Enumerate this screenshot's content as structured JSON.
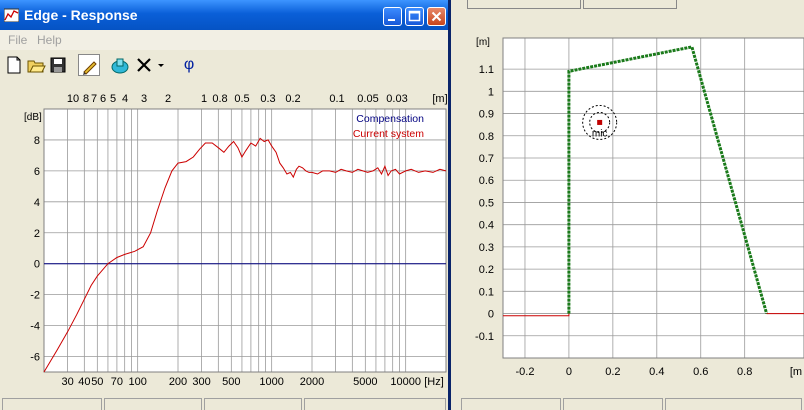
{
  "window": {
    "title": "Edge - Response"
  },
  "menu": {
    "file": "File",
    "help": "Help"
  },
  "icons": [
    "app-icon",
    "minimize-icon",
    "maximize-icon",
    "close-icon",
    "new-file-icon",
    "open-folder-icon",
    "save-icon",
    "pencil-icon",
    "mic-icon",
    "delete-icon",
    "dropdown-arrow-icon",
    "phase-icon"
  ],
  "toolbar": {
    "phase_symbol": "φ"
  },
  "response_chart": {
    "type": "line",
    "ylabel": "[dB]",
    "ylim": [
      -7,
      10
    ],
    "yticks": [
      8,
      6,
      4,
      2,
      0,
      -2,
      -4,
      -6
    ],
    "xlabel": "[Hz]",
    "xlim": [
      20,
      20000
    ],
    "xscale": "log",
    "xticks": [
      {
        "v": 30,
        "label": "30"
      },
      {
        "v": 40,
        "label": "40"
      },
      {
        "v": 50,
        "label": "50"
      },
      {
        "v": 70,
        "label": "70"
      },
      {
        "v": 100,
        "label": "100"
      },
      {
        "v": 200,
        "label": "200"
      },
      {
        "v": 300,
        "label": "300"
      },
      {
        "v": 500,
        "label": "500"
      },
      {
        "v": 1000,
        "label": "1000"
      },
      {
        "v": 2000,
        "label": "2000"
      },
      {
        "v": 5000,
        "label": "5000"
      },
      {
        "v": 10000,
        "label": "10000"
      }
    ],
    "top_axis_label": "[m]",
    "top_ticks": [
      "10",
      "8",
      "7",
      "6",
      "5",
      "4",
      "3",
      "2",
      "1",
      "0.8",
      "0.5",
      "0.3",
      "0.2",
      "0.1",
      "0.05",
      "0.03"
    ],
    "grid": true,
    "legend_position": "top-right",
    "series": [
      {
        "name": "Compensation",
        "color": "#000080",
        "points": [
          [
            20,
            0
          ],
          [
            20000,
            0
          ]
        ]
      },
      {
        "name": "Current system",
        "color": "#cc0000",
        "points": [
          [
            20,
            -7
          ],
          [
            25,
            -5.6
          ],
          [
            30,
            -4.4
          ],
          [
            35,
            -3.3
          ],
          [
            40,
            -2.3
          ],
          [
            45,
            -1.4
          ],
          [
            50,
            -0.8
          ],
          [
            60,
            0
          ],
          [
            70,
            0.4
          ],
          [
            80,
            0.6
          ],
          [
            95,
            0.8
          ],
          [
            110,
            1.1
          ],
          [
            125,
            2
          ],
          [
            140,
            3.4
          ],
          [
            160,
            4.9
          ],
          [
            180,
            6
          ],
          [
            200,
            6.5
          ],
          [
            230,
            6.6
          ],
          [
            260,
            6.9
          ],
          [
            290,
            7.4
          ],
          [
            320,
            7.8
          ],
          [
            360,
            7.8
          ],
          [
            400,
            7.5
          ],
          [
            440,
            7.2
          ],
          [
            480,
            7.6
          ],
          [
            520,
            7.9
          ],
          [
            560,
            7.5
          ],
          [
            600,
            6.9
          ],
          [
            640,
            7.3
          ],
          [
            700,
            7.8
          ],
          [
            760,
            7.6
          ],
          [
            820,
            8.1
          ],
          [
            880,
            7.9
          ],
          [
            940,
            8
          ],
          [
            1000,
            7.6
          ],
          [
            1080,
            7.2
          ],
          [
            1150,
            6.5
          ],
          [
            1220,
            6.2
          ],
          [
            1300,
            5.8
          ],
          [
            1380,
            5.9
          ],
          [
            1450,
            5.6
          ],
          [
            1530,
            6.1
          ],
          [
            1600,
            6.3
          ],
          [
            1700,
            6.2
          ],
          [
            1800,
            6
          ],
          [
            1900,
            5.9
          ],
          [
            2000,
            5.9
          ],
          [
            2200,
            5.8
          ],
          [
            2400,
            6
          ],
          [
            2700,
            6
          ],
          [
            3000,
            5.9
          ],
          [
            3300,
            6.1
          ],
          [
            3600,
            6
          ],
          [
            4000,
            5.9
          ],
          [
            4400,
            6.1
          ],
          [
            4800,
            6
          ],
          [
            5200,
            5.9
          ],
          [
            5700,
            6
          ],
          [
            6200,
            6.2
          ],
          [
            6600,
            5.8
          ],
          [
            7000,
            6.3
          ],
          [
            7400,
            5.7
          ],
          [
            7800,
            6
          ],
          [
            8400,
            6.1
          ],
          [
            9000,
            5.8
          ],
          [
            10000,
            6
          ],
          [
            11000,
            6.1
          ],
          [
            12500,
            5.9
          ],
          [
            14000,
            6
          ],
          [
            16000,
            5.9
          ],
          [
            18000,
            6.1
          ],
          [
            20000,
            6
          ]
        ]
      }
    ]
  },
  "room_chart": {
    "type": "line",
    "ylabel": "[m]",
    "xlabel": "[m",
    "xlim": [
      -0.3,
      1.07
    ],
    "ylim": [
      -0.2,
      1.24
    ],
    "xticks": [
      "-0.2",
      "0",
      "0.2",
      "0.4",
      "0.6",
      "0.8"
    ],
    "yticks": [
      "1.1",
      "1",
      "0.9",
      "0.8",
      "0.7",
      "0.6",
      "0.5",
      "0.4",
      "0.3",
      "0.2",
      "0.1",
      "0",
      "-0.1"
    ],
    "grid": true,
    "series": [
      {
        "name": "",
        "color": "#1a7a1a",
        "points": [
          [
            0,
            0
          ],
          [
            0,
            1.09
          ],
          [
            0.56,
            1.2
          ],
          [
            0.9,
            0
          ]
        ]
      },
      {
        "name": "",
        "color": "#cc0000",
        "points": [
          [
            -0.3,
            -0.01
          ],
          [
            0,
            -0.01
          ],
          [
            0,
            0
          ]
        ]
      },
      {
        "name": "",
        "color": "#cc0000",
        "points": [
          [
            0.9,
            0
          ],
          [
            1.07,
            0
          ]
        ]
      }
    ],
    "mic": {
      "x": 0.14,
      "y": 0.86,
      "label": "mic"
    }
  }
}
